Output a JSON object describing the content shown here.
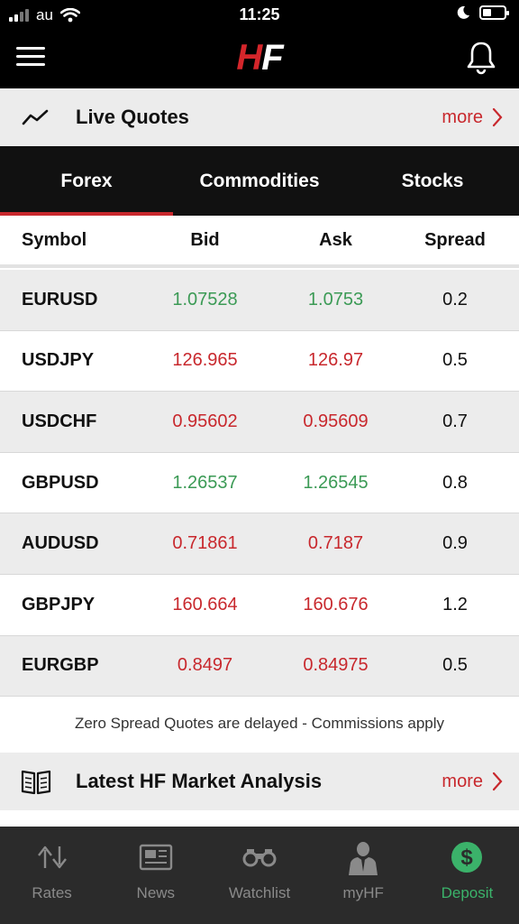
{
  "status_bar": {
    "carrier": "au",
    "time": "11:25"
  },
  "header": {
    "logo_h": "H",
    "logo_f": "F"
  },
  "live_quotes": {
    "title": "Live Quotes",
    "more": "more"
  },
  "tabs": [
    {
      "label": "Forex",
      "active": true
    },
    {
      "label": "Commodities",
      "active": false
    },
    {
      "label": "Stocks",
      "active": false
    }
  ],
  "table": {
    "headers": {
      "symbol": "Symbol",
      "bid": "Bid",
      "ask": "Ask",
      "spread": "Spread"
    },
    "rows": [
      {
        "symbol": "EURUSD",
        "bid": "1.07528",
        "ask": "1.0753",
        "spread": "0.2",
        "direction": "up"
      },
      {
        "symbol": "USDJPY",
        "bid": "126.965",
        "ask": "126.97",
        "spread": "0.5",
        "direction": "down"
      },
      {
        "symbol": "USDCHF",
        "bid": "0.95602",
        "ask": "0.95609",
        "spread": "0.7",
        "direction": "down"
      },
      {
        "symbol": "GBPUSD",
        "bid": "1.26537",
        "ask": "1.26545",
        "spread": "0.8",
        "direction": "up"
      },
      {
        "symbol": "AUDUSD",
        "bid": "0.71861",
        "ask": "0.7187",
        "spread": "0.9",
        "direction": "down"
      },
      {
        "symbol": "GBPJPY",
        "bid": "160.664",
        "ask": "160.676",
        "spread": "1.2",
        "direction": "down"
      },
      {
        "symbol": "EURGBP",
        "bid": "0.8497",
        "ask": "0.84975",
        "spread": "0.5",
        "direction": "down"
      }
    ]
  },
  "note": "Zero Spread Quotes are delayed - Commissions apply",
  "analysis": {
    "title": "Latest HF Market Analysis",
    "more": "more"
  },
  "bottom_nav": [
    {
      "label": "Rates",
      "icon": "rates-arrows-icon",
      "active": false
    },
    {
      "label": "News",
      "icon": "newspaper-icon",
      "active": false
    },
    {
      "label": "Watchlist",
      "icon": "binoculars-icon",
      "active": false
    },
    {
      "label": "myHF",
      "icon": "person-suit-icon",
      "active": false
    },
    {
      "label": "Deposit",
      "icon": "dollar-coin-icon",
      "active": true
    }
  ],
  "colors": {
    "brand_red": "#c8282d",
    "price_up": "#3b9a55",
    "active_green": "#3bb26a"
  }
}
